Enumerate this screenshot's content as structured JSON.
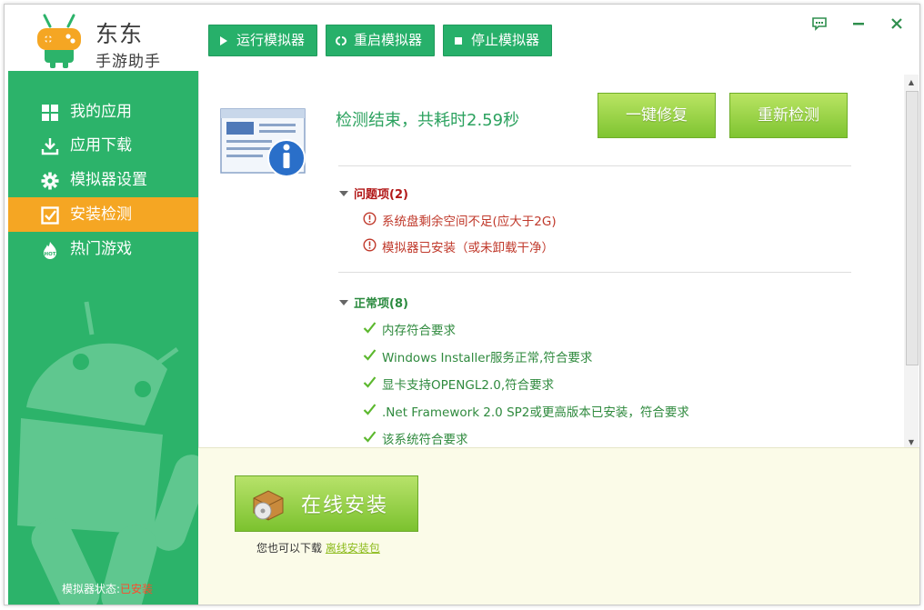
{
  "app": {
    "brand_line1": "东东",
    "brand_line2": "手游助手"
  },
  "toolbar": {
    "run_label": "运行模拟器",
    "restart_label": "重启模拟器",
    "stop_label": "停止模拟器"
  },
  "window_controls": [
    "feedback-icon",
    "minimize-icon",
    "close-icon"
  ],
  "sidebar": {
    "items": [
      {
        "label": "我的应用",
        "icon": "grid-icon"
      },
      {
        "label": "应用下载",
        "icon": "download-icon"
      },
      {
        "label": "模拟器设置",
        "icon": "gear-icon"
      },
      {
        "label": "安装检测",
        "icon": "checkbox-icon",
        "active": true
      },
      {
        "label": "热门游戏",
        "icon": "hot-fire-icon"
      }
    ],
    "status_label": "模拟器状态:",
    "status_value": "已安装"
  },
  "main": {
    "result_text": "检测结束，共耗时",
    "result_time": "2.59秒",
    "fix_button": "一键修复",
    "recheck_button": "重新检测",
    "problems": {
      "title": "问题项(2)",
      "items": [
        "系统盘剩余空间不足(应大于2G)",
        "模拟器已安装（或未卸载干净）"
      ]
    },
    "normal": {
      "title": "正常项(8)",
      "items": [
        "内存符合要求",
        "Windows Installer服务正常,符合要求",
        "显卡支持OPENGL2.0,符合要求",
        ".Net Framework 2.0 SP2或更高版本已安装，符合要求",
        "该系统符合要求"
      ]
    }
  },
  "bottom": {
    "install_label": "在线安装",
    "download_prefix": "您也可以下载",
    "download_link": "离线安装包"
  },
  "colors": {
    "primary_green": "#27b06a",
    "sidebar_green": "#2cb36a",
    "active_orange": "#f5a623",
    "error_red": "#c0392b",
    "ok_green": "#2f8a3e",
    "button_green": "#8fce3a"
  }
}
